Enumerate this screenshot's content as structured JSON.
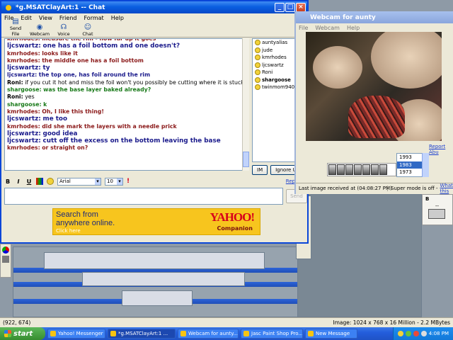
{
  "chat_window": {
    "title": "*g.MSATClayArt:1 -- Chat",
    "menu": [
      "File",
      "Edit",
      "View",
      "Friend",
      "Format",
      "Help"
    ],
    "toolbar": [
      {
        "label": "Send File",
        "icon": "send-file-icon"
      },
      {
        "label": "Webcam",
        "icon": "webcam-icon"
      },
      {
        "label": "Voice",
        "icon": "voice-icon"
      },
      {
        "label": "Chat",
        "icon": "chat-icon"
      }
    ],
    "messages": [
      {
        "user": "kmrhodes:",
        "text": "measure the rim - how far up it goes",
        "color": "#8b1a1a",
        "big": false
      },
      {
        "user": "ljcswartz:",
        "text": "one has a foil bottom and one doesn't?",
        "color": "#1a1a8b",
        "big": true
      },
      {
        "user": "kmrhodes:",
        "text": "looks like it",
        "color": "#8b1a1a",
        "big": false
      },
      {
        "user": "kmrhodes:",
        "text": "the middle one has a foil bottom",
        "color": "#8b1a1a",
        "big": false
      },
      {
        "user": "ljcswartz:",
        "text": "ty",
        "color": "#1a1a8b",
        "big": true
      },
      {
        "user": "ljcswartz:",
        "text": "the top one, has foil around the rim",
        "color": "#1a1a8b",
        "big": false
      },
      {
        "user": "Roni:",
        "text": "if you cut it hot and miss the foil won't you possibly be cutting where it is stuck",
        "color": "#000000",
        "big": false
      },
      {
        "user": "shargoose:",
        "text": "was the base layer baked already?",
        "color": "#1a7a1a",
        "big": false
      },
      {
        "user": "Roni:",
        "text": "yes",
        "color": "#000000",
        "big": false
      },
      {
        "user": "shargoose:",
        "text": "k",
        "color": "#1a7a1a",
        "big": false
      },
      {
        "user": "kmrhodes:",
        "text": "Oh, I like this thing!",
        "color": "#8b1a1a",
        "big": false
      },
      {
        "user": "ljcswartz:",
        "text": "me too",
        "color": "#1a1a8b",
        "big": true
      },
      {
        "user": "kmrhodes:",
        "text": "did she mark the layers with a needle prick",
        "color": "#8b1a1a",
        "big": false
      },
      {
        "user": "ljcswartz:",
        "text": "good idea",
        "color": "#1a1a8b",
        "big": true
      },
      {
        "user": "ljcswartz:",
        "text": "cutt off the excess on the bottom leaving the base",
        "color": "#1a1a8b",
        "big": true
      },
      {
        "user": "kmrhodes:",
        "text": "or straight on?",
        "color": "#8b1a1a",
        "big": false
      }
    ],
    "users": [
      {
        "name": "auntyalias",
        "bold": false
      },
      {
        "name": "jude",
        "bold": false
      },
      {
        "name": "kmrhodes",
        "bold": false
      },
      {
        "name": "ljcswartz",
        "bold": false
      },
      {
        "name": "Roni",
        "bold": false
      },
      {
        "name": "shargoose",
        "bold": true
      },
      {
        "name": "twinmom94002",
        "bold": false
      }
    ],
    "im_button": "IM",
    "ignore_button": "Ignore U",
    "format": {
      "bold": "B",
      "italic": "I",
      "underline": "U",
      "font": "Arial",
      "size": "10"
    },
    "report_link": "Report A",
    "send_button": "Send",
    "ad": {
      "line1": "Search from",
      "line2": "anywhere online.",
      "line3": "Click here",
      "logo": "YAHOO!",
      "sub": "Companion"
    }
  },
  "webcam_window": {
    "title": "Webcam for aunty",
    "menu": [
      "File",
      "Webcam",
      "Help"
    ],
    "report_link": "Report Abu",
    "years": [
      "1993",
      "1983",
      "1973"
    ],
    "selected_year": "1983",
    "status_left": "Last image received at (04:08:27 PM)",
    "status_right": "Super mode is off -",
    "status_link": "What's this"
  },
  "mail_window": {
    "label": "B",
    "label2": "--"
  },
  "image_status": {
    "coords": "(922, 674)",
    "info": "Image: 1024 x 768 x 16 Million - 2.2 MBytes"
  },
  "taskbar": {
    "start": "start",
    "tasks": [
      "Yahoo! Messenger ...",
      "*g.MSATClayArt:1 ...",
      "Webcam for aunty...",
      "Jasc Paint Shop Pro...",
      "New Message"
    ],
    "time": "4:08 PM"
  }
}
